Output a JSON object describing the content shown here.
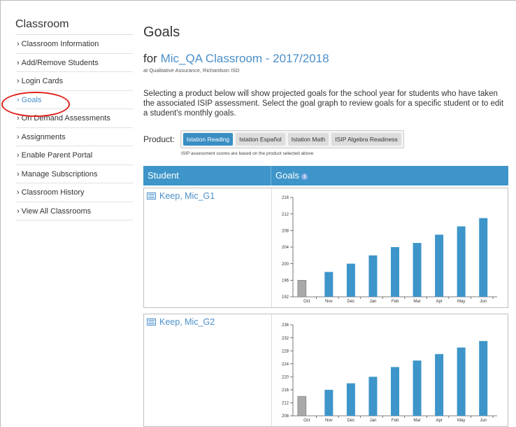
{
  "sidebar": {
    "title": "Classroom",
    "items": [
      {
        "label": "Classroom Information",
        "active": false
      },
      {
        "label": "Add/Remove Students",
        "active": false
      },
      {
        "label": "Login Cards",
        "active": false
      },
      {
        "label": "Goals",
        "active": true
      },
      {
        "label": "On Demand Assessments",
        "active": false
      },
      {
        "label": "Assignments",
        "active": false
      },
      {
        "label": "Enable Parent Portal",
        "active": false
      },
      {
        "label": "Manage Subscriptions",
        "active": false
      },
      {
        "label": "Classroom History",
        "active": false
      },
      {
        "label": "View All Classrooms",
        "active": false
      }
    ]
  },
  "main": {
    "title": "Goals",
    "subtitle_prefix": "for",
    "classroom": "Mic_QA Classroom - 2017/2018",
    "school": "at Qualitative Assurance, Richardson ISD",
    "intro": "Selecting a product below will show projected goals for the school year for students who have taken the associated ISIP assessment. Select the goal graph to review goals for a specific student or to edit a student's monthly goals.",
    "product_label": "Product:",
    "products": [
      {
        "label": "Istation Reading",
        "active": true
      },
      {
        "label": "Istation Español",
        "active": false
      },
      {
        "label": "Istation Math",
        "active": false
      },
      {
        "label": "ISIP Algebra Readiness",
        "active": false
      }
    ],
    "product_note": "ISIP assessment scores are based on the product selected above"
  },
  "table": {
    "col_student": "Student",
    "col_goals": "Goals",
    "info_icon": "i"
  },
  "colors": {
    "accent": "#3d95c9",
    "bar": "#3d95c9",
    "actual_bar": "#a9a9a9",
    "highlight": "#e0211c"
  },
  "students": [
    {
      "name": "Keep, Mic_G1",
      "chart_data": {
        "type": "bar",
        "categories": [
          "Oct",
          "Nov",
          "Dec",
          "Jan",
          "Feb",
          "Mar",
          "Apr",
          "May",
          "Jun"
        ],
        "actual": [
          196,
          null,
          null,
          null,
          null,
          null,
          null,
          null,
          null
        ],
        "goals": [
          null,
          198,
          200,
          202,
          204,
          205,
          207,
          209,
          211
        ],
        "ylim": [
          192,
          216
        ],
        "yticks": [
          192,
          196,
          200,
          204,
          208,
          212,
          216
        ]
      }
    },
    {
      "name": "Keep, Mic_G2",
      "chart_data": {
        "type": "bar",
        "categories": [
          "Oct",
          "Nov",
          "Dec",
          "Jan",
          "Feb",
          "Mar",
          "Apr",
          "May",
          "Jun"
        ],
        "actual": [
          214,
          null,
          null,
          null,
          null,
          null,
          null,
          null,
          null
        ],
        "goals": [
          null,
          216,
          218,
          220,
          223,
          225,
          227,
          229,
          231
        ],
        "ylim": [
          208,
          236
        ],
        "yticks": [
          208,
          212,
          216,
          220,
          224,
          228,
          232,
          236
        ]
      }
    }
  ]
}
